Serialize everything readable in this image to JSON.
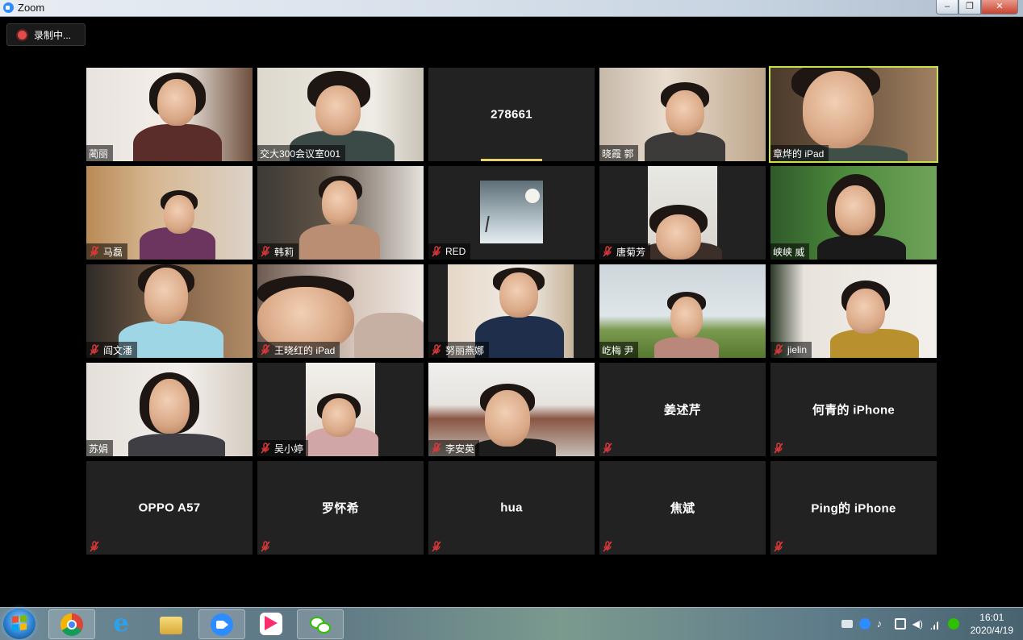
{
  "window": {
    "title": "Zoom"
  },
  "recording": {
    "label": "录制中..."
  },
  "tiles": [
    {
      "name": "蔺丽",
      "video": true,
      "muted": false,
      "active": false
    },
    {
      "name": "交大300会议室001",
      "video": true,
      "muted": false,
      "active": false
    },
    {
      "name": "278661",
      "video": false,
      "muted": false,
      "active": false,
      "center": true,
      "speaking_bar": true
    },
    {
      "name": "晓霞 郭",
      "video": true,
      "muted": false,
      "active": false
    },
    {
      "name": "章烨的 iPad",
      "video": true,
      "muted": false,
      "active": true
    },
    {
      "name": "马磊",
      "video": true,
      "muted": true,
      "active": false
    },
    {
      "name": "韩莉",
      "video": true,
      "muted": true,
      "active": false
    },
    {
      "name": "RED",
      "video": true,
      "muted": true,
      "active": false
    },
    {
      "name": "唐菊芳",
      "video": true,
      "muted": true,
      "active": false
    },
    {
      "name": "峡峡 威",
      "video": true,
      "muted": false,
      "active": false
    },
    {
      "name": "阎文潘",
      "video": true,
      "muted": true,
      "active": false
    },
    {
      "name": "王晓红的 iPad",
      "video": true,
      "muted": true,
      "active": false
    },
    {
      "name": "努丽燕娜",
      "video": true,
      "muted": true,
      "active": false
    },
    {
      "name": "屹梅 尹",
      "video": true,
      "muted": false,
      "active": false
    },
    {
      "name": "jielin",
      "video": true,
      "muted": true,
      "active": false
    },
    {
      "name": "苏娟",
      "video": true,
      "muted": false,
      "active": false
    },
    {
      "name": "吴小婷",
      "video": true,
      "muted": true,
      "active": false
    },
    {
      "name": "李安英",
      "video": true,
      "muted": true,
      "active": false
    },
    {
      "name": "姜述芹",
      "video": false,
      "muted": true,
      "active": false,
      "center": true
    },
    {
      "name": "何青的 iPhone",
      "video": false,
      "muted": true,
      "active": false,
      "center": true
    },
    {
      "name": "OPPO A57",
      "video": false,
      "muted": true,
      "active": false,
      "center": true
    },
    {
      "name": "罗怀希",
      "video": false,
      "muted": true,
      "active": false,
      "center": true
    },
    {
      "name": "hua",
      "video": false,
      "muted": true,
      "active": false,
      "center": true
    },
    {
      "name": "焦斌",
      "video": false,
      "muted": true,
      "active": false,
      "center": true
    },
    {
      "name": "Ping的 iPhone",
      "video": false,
      "muted": true,
      "active": false,
      "center": true
    }
  ],
  "taskbar": {
    "apps": [
      "start-button",
      "chrome-icon",
      "ie-icon",
      "folder-icon",
      "zoom-icon",
      "youku-icon",
      "wechat-icon"
    ],
    "clock_time": "16:01",
    "clock_date": "2020/4/19"
  },
  "colors": {
    "active_border": "#c5e14b",
    "mute_red": "#e0393b",
    "tile_bg": "#222222"
  }
}
